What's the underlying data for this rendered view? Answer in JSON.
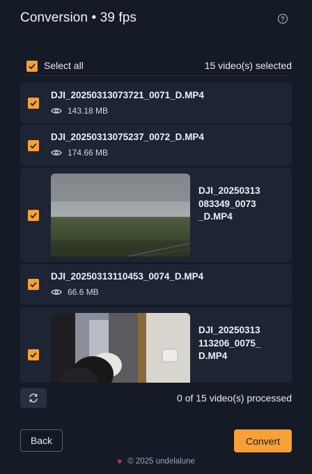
{
  "header": {
    "title": "Conversion • 39 fps",
    "help_icon": "help-circle-icon"
  },
  "selection": {
    "select_all_label": "Select all",
    "selected_count": "15 video(s) selected",
    "checked": true
  },
  "videos": [
    {
      "name": "DJI_20250313073721_0071_D.MP4",
      "size": "143.18 MB",
      "checked": true,
      "has_thumbnail": false
    },
    {
      "name": "DJI_20250313075237_0072_D.MP4",
      "size": "174.66 MB",
      "checked": true,
      "has_thumbnail": false
    },
    {
      "name": "DJI_20250313083349_0073_D.MP4",
      "checked": true,
      "has_thumbnail": true,
      "thumbnail": "overcast-field"
    },
    {
      "name": "DJI_20250313110453_0074_D.MP4",
      "size": "66.6 MB",
      "checked": true,
      "has_thumbnail": false
    },
    {
      "name": "DJI_20250313113206_0075_D.MP4",
      "checked": true,
      "has_thumbnail": true,
      "thumbnail": "hallway"
    }
  ],
  "footer": {
    "refresh_icon": "refresh-icon",
    "processed_text": "0 of 15 video(s) processed"
  },
  "actions": {
    "back_label": "Back",
    "convert_label": "Convert"
  },
  "credit": {
    "text": "© 2025 undelalune",
    "icon": "heart-icon"
  },
  "colors": {
    "background": "#141a26",
    "card": "#1d2433",
    "accent": "#f7a035",
    "heart": "#b0404a"
  }
}
